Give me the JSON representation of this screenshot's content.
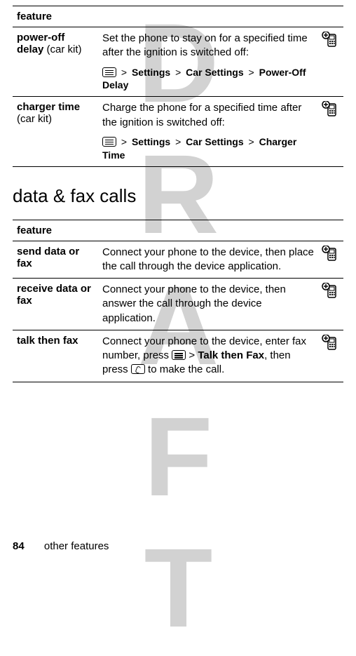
{
  "watermark": "DRAFT",
  "table1": {
    "header": "feature",
    "rows": [
      {
        "feature_bold": "power-off delay",
        "feature_rest": " (car kit)",
        "desc": "Set the phone to stay on for a specified time after the ignition is switched off:",
        "path": [
          "Settings",
          "Car Settings",
          "Power-Off Delay"
        ]
      },
      {
        "feature_bold": "charger time",
        "feature_rest": " (car kit)",
        "desc": "Charge the phone for a specified time after the ignition is switched off:",
        "path": [
          "Settings",
          "Car Settings",
          "Charger Time"
        ]
      }
    ]
  },
  "section_title": "data & fax calls",
  "table2": {
    "header": "feature",
    "rows": [
      {
        "feature_bold": "send data or fax",
        "feature_rest": "",
        "desc": "Connect your phone to the device, then place the call through the device application."
      },
      {
        "feature_bold": "receive data or fax",
        "feature_rest": "",
        "desc": "Connect your phone to the device, then answer the call through the device application."
      },
      {
        "feature_bold": "talk then fax",
        "feature_rest": "",
        "desc_pre": "Connect your phone to the device, enter fax number, press ",
        "talk_then_fax": "Talk then Fax",
        "desc_mid": ", then press ",
        "desc_post": " to make the call."
      }
    ]
  },
  "footer": {
    "page": "84",
    "section": "other features"
  }
}
